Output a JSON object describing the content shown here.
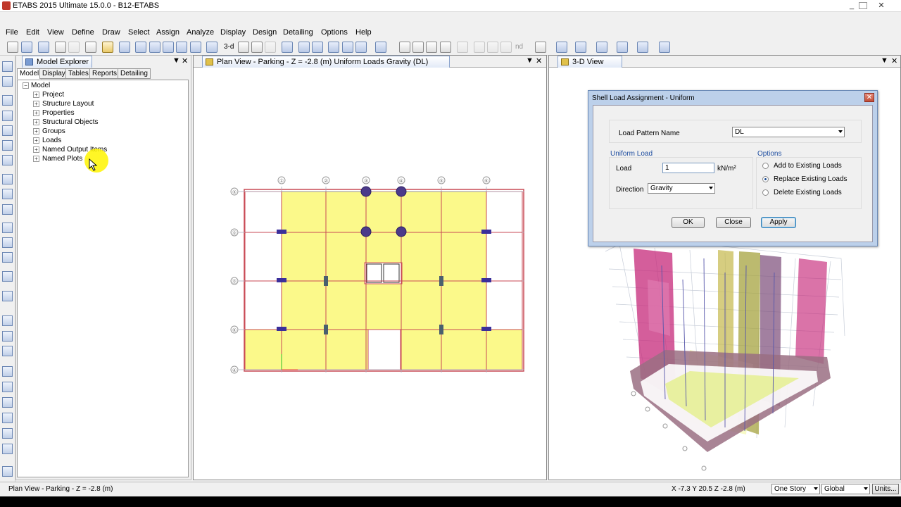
{
  "window": {
    "title": "ETABS 2015 Ultimate 15.0.0 - B12-ETABS"
  },
  "menu": [
    "File",
    "Edit",
    "View",
    "Define",
    "Draw",
    "Select",
    "Assign",
    "Analyze",
    "Display",
    "Design",
    "Detailing",
    "Options",
    "Help"
  ],
  "toolbar": {
    "view3d_label": "3-d",
    "nd_label": "nd"
  },
  "model_explorer": {
    "title": "Model Explorer",
    "tabs": [
      "Model",
      "Display",
      "Tables",
      "Reports",
      "Detailing"
    ],
    "active_tab": "Model",
    "root": "Model",
    "items": [
      "Project",
      "Structure Layout",
      "Properties",
      "Structural Objects",
      "Groups",
      "Loads",
      "Named Output Items",
      "Named Plots"
    ]
  },
  "plan_view": {
    "title": "Plan View - Parking - Z = -2.8 (m)  Uniform Loads Gravity  (DL)",
    "grid_bubbles": [
      "①",
      "②",
      "③",
      "④",
      "⑤",
      "⑥",
      "⑤",
      "⓪",
      "⓪",
      "⑥",
      "④"
    ]
  },
  "view3d": {
    "title": "3-D View"
  },
  "dialog": {
    "title": "Shell Load Assignment - Uniform",
    "load_pattern_label": "Load Pattern Name",
    "load_pattern_value": "DL",
    "uniform_load_group": "Uniform Load",
    "load_label": "Load",
    "load_value": "1",
    "load_unit": "kN/m²",
    "direction_label": "Direction",
    "direction_value": "Gravity",
    "options_group": "Options",
    "options": [
      "Add to Existing Loads",
      "Replace Existing Loads",
      "Delete Existing Loads"
    ],
    "selected_option": "Replace Existing Loads",
    "ok": "OK",
    "close": "Close",
    "apply": "Apply"
  },
  "status": {
    "left": "Plan View - Parking - Z = -2.8 (m)",
    "coords": "X -7.3  Y 20.5  Z -2.8 (m)",
    "story_select": "One Story",
    "coord_select": "Global",
    "units_button": "Units..."
  }
}
